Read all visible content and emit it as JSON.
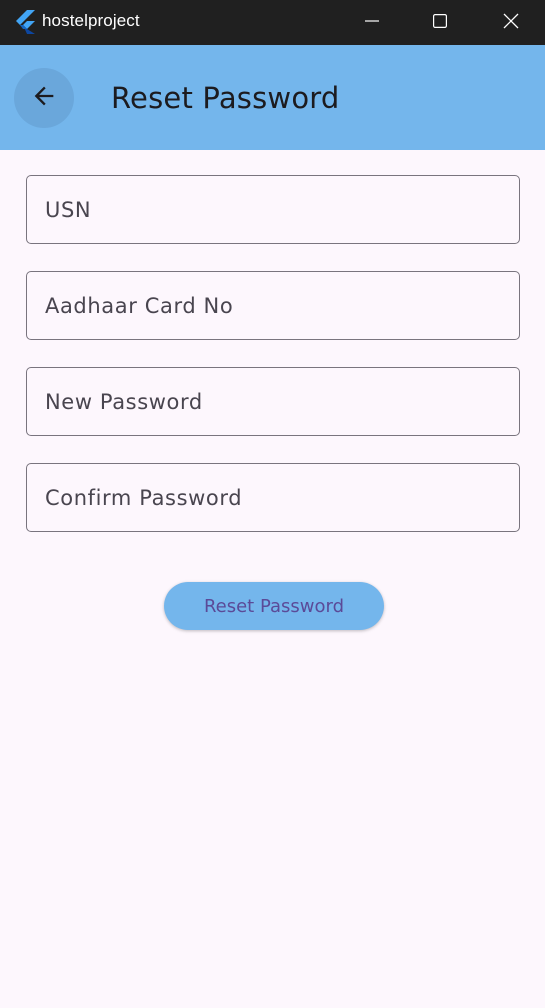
{
  "window": {
    "title": "hostelproject",
    "controls": {
      "minimize_icon": "minimize-icon",
      "maximize_icon": "maximize-icon",
      "close_icon": "close-icon"
    }
  },
  "app_bar": {
    "title": "Reset Password",
    "back_icon": "arrow-left-icon",
    "background": "#74b6ec"
  },
  "form": {
    "fields": [
      {
        "label": "USN",
        "value": ""
      },
      {
        "label": "Aadhaar Card No",
        "value": ""
      },
      {
        "label": "New Password",
        "value": ""
      },
      {
        "label": "Confirm Password",
        "value": ""
      }
    ],
    "submit_label": "Reset Password"
  },
  "colors": {
    "accent": "#74b6ec",
    "button_text": "#5b4a98",
    "page_background": "#fdf7fd",
    "titlebar": "#202020"
  }
}
